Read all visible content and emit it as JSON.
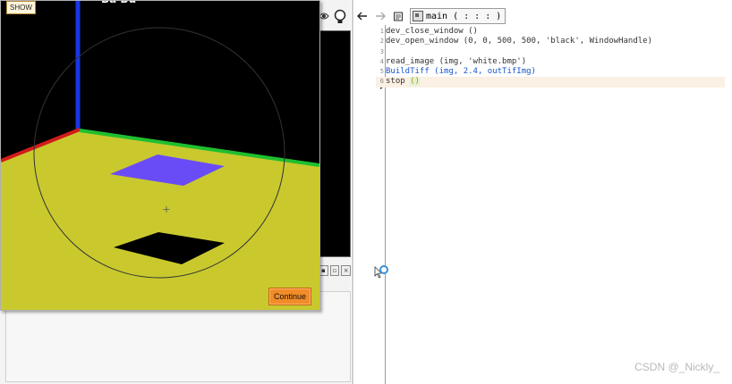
{
  "graphics_window": {
    "show_label": "SHOW",
    "continue_label": "Continue"
  },
  "editor": {
    "procedure_label": "main ( : : : )",
    "lines": [
      {
        "n": "1",
        "text": "dev_close_window ()",
        "style": "normal"
      },
      {
        "n": "2",
        "text": "dev_open_window (0, 0, 500, 500, 'black', WindowHandle)",
        "style": "normal"
      },
      {
        "n": "3",
        "text": "",
        "style": "normal"
      },
      {
        "n": "4",
        "text": "read_image (img, 'white.bmp')",
        "style": "normal"
      },
      {
        "n": "5",
        "text": "BuildTiff (img, 2.4, outTifImg)",
        "style": "blue"
      },
      {
        "n": "6",
        "text": "stop ",
        "bracket": "()",
        "style": "current"
      }
    ]
  },
  "watermark": "CSDN @_Nickly_",
  "colors": {
    "floor": "#c9c92e",
    "axis_red": "#d21c1c",
    "axis_green": "#1fbf2f",
    "axis_blue": "#1836e6",
    "square_top": "#6a4cf6",
    "continue_button": "#f28c28",
    "keyword_blue": "#1a56c8"
  },
  "icons": [
    "back-arrow-icon",
    "forward-arrow-icon",
    "clipboard-icon",
    "procedure-icon",
    "lightbulb-icon",
    "eye-icon",
    "mouse-cursor-icon"
  ]
}
